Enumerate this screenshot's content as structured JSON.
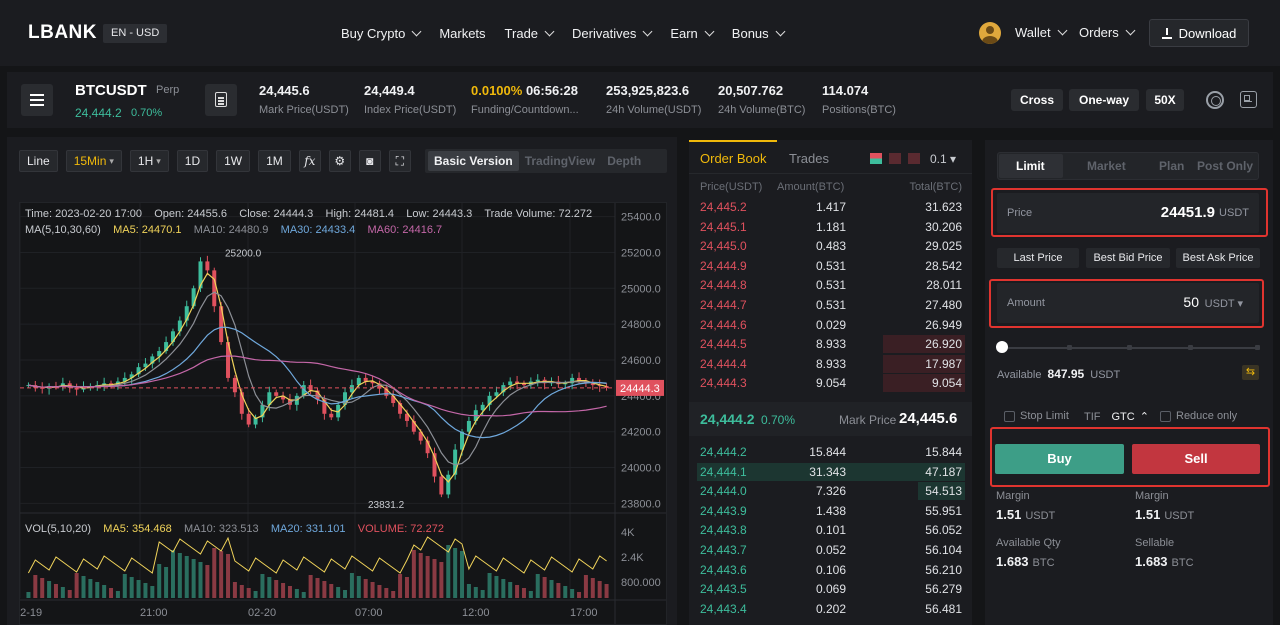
{
  "nav": {
    "logo": "LBANK",
    "lang": "EN - USD",
    "items": [
      "Buy Crypto",
      "Markets",
      "Trade",
      "Derivatives",
      "Earn",
      "Bonus"
    ],
    "wallet": "Wallet",
    "orders": "Orders",
    "download": "Download"
  },
  "ticker": {
    "symbol": "BTCUSDT",
    "tag": "Perp",
    "price": "24,444.2",
    "change": "0.70%",
    "stats": [
      {
        "value": "24,445.6",
        "label": "Mark Price(USDT)"
      },
      {
        "value": "24,449.4",
        "label": "Index Price(USDT)"
      },
      {
        "value": "0.0100%",
        "value2": "06:56:28",
        "label": "Funding/Countdown..."
      },
      {
        "value": "253,925,823.6",
        "label": "24h Volume(USDT)"
      },
      {
        "value": "20,507.762",
        "label": "24h Volume(BTC)"
      },
      {
        "value": "114.074",
        "label": "Positions(BTC)"
      }
    ],
    "pills": [
      "Cross",
      "One-way",
      "50X"
    ],
    "colors": {
      "funding": "#f0b90b",
      "up": "#3dbd9c",
      "down": "#e0515e"
    }
  },
  "chart_toolbar": {
    "buttons": [
      "Line",
      "15Min",
      "1H",
      "1D",
      "1W",
      "1M"
    ],
    "active": "15Min",
    "icons": [
      "fx-icon",
      "settings-icon",
      "camera-icon",
      "fullscreen-icon"
    ],
    "views": [
      "Basic Version",
      "TradingView",
      "Depth"
    ],
    "active_view": "Basic Version"
  },
  "chart_info": {
    "time": "Time: 2023-02-20 17:00",
    "open": "Open: 24455.6",
    "close": "Close: 24444.3",
    "high": "High: 24481.4",
    "low": "Low: 24443.3",
    "trade_volume": "Trade Volume: 72.272",
    "ma_label": "MA(5,10,30,60)",
    "ma5": "MA5: 24470.1",
    "ma10": "MA10: 24480.9",
    "ma30": "MA30: 24433.4",
    "ma60": "MA60: 24416.7",
    "vol_label": "VOL(5,10,20)",
    "vma5": "MA5: 354.468",
    "vma10": "MA10: 323.513",
    "vma20": "MA20: 331.101",
    "volume": "VOLUME: 72.272",
    "high_mark": "25200.0",
    "low_mark": "23831.2",
    "last_price": "24444.3"
  },
  "chart_data": {
    "type": "candlestick",
    "y_ticks": [
      "25400.0",
      "25200.0",
      "25000.0",
      "24800.0",
      "24600.0",
      "24400.0",
      "24200.0",
      "24000.0",
      "23800.0"
    ],
    "ylim": [
      23780,
      25420
    ],
    "x_ticks": [
      "02-19",
      "21:00",
      "02-20",
      "07:00",
      "12:00",
      "17:00"
    ],
    "volume_ticks": [
      "4K",
      "2.4K",
      "800.000"
    ],
    "close_path": [
      24460,
      24445,
      24440,
      24455,
      24450,
      24470,
      24445,
      24435,
      24450,
      24455,
      24460,
      24470,
      24455,
      24480,
      24500,
      24520,
      24560,
      24580,
      24620,
      24650,
      24700,
      24760,
      24820,
      24900,
      25000,
      25150,
      25100,
      24900,
      24700,
      24500,
      24420,
      24300,
      24240,
      24280,
      24350,
      24420,
      24400,
      24380,
      24350,
      24400,
      24460,
      24430,
      24380,
      24300,
      24280,
      24350,
      24420,
      24460,
      24500,
      24480,
      24470,
      24440,
      24400,
      24360,
      24300,
      24260,
      24200,
      24150,
      24080,
      23950,
      23850,
      23960,
      24100,
      24200,
      24260,
      24320,
      24350,
      24400,
      24420,
      24460,
      24480,
      24470,
      24460,
      24480,
      24490,
      24470,
      24480,
      24465,
      24470,
      24500,
      24485,
      24470,
      24460,
      24455,
      24444
    ]
  },
  "order_book": {
    "tabs": [
      "Order Book",
      "Trades"
    ],
    "precision": "0.1",
    "headers": [
      "Price(USDT)",
      "Amount(BTC)",
      "Total(BTC)"
    ],
    "asks": [
      [
        "24,445.2",
        "1.417",
        "31.623"
      ],
      [
        "24,445.1",
        "1.181",
        "30.206"
      ],
      [
        "24,445.0",
        "0.483",
        "29.025"
      ],
      [
        "24,444.9",
        "0.531",
        "28.542"
      ],
      [
        "24,444.8",
        "0.531",
        "28.011"
      ],
      [
        "24,444.7",
        "0.531",
        "27.480"
      ],
      [
        "24,444.6",
        "0.029",
        "26.949"
      ],
      [
        "24,444.5",
        "8.933",
        "26.920"
      ],
      [
        "24,444.4",
        "8.933",
        "17.987"
      ],
      [
        "24,444.3",
        "9.054",
        "9.054"
      ]
    ],
    "mid_price": "24,444.2",
    "mid_change": "0.70%",
    "mark_label": "Mark Price",
    "mark_price": "24,445.6",
    "bids": [
      [
        "24,444.2",
        "15.844",
        "15.844"
      ],
      [
        "24,444.1",
        "31.343",
        "47.187"
      ],
      [
        "24,444.0",
        "7.326",
        "54.513"
      ],
      [
        "24,443.9",
        "1.438",
        "55.951"
      ],
      [
        "24,443.8",
        "0.101",
        "56.052"
      ],
      [
        "24,443.7",
        "0.052",
        "56.104"
      ],
      [
        "24,443.6",
        "0.106",
        "56.210"
      ],
      [
        "24,443.5",
        "0.069",
        "56.279"
      ],
      [
        "24,443.4",
        "0.202",
        "56.481"
      ]
    ]
  },
  "trade": {
    "tabs": [
      "Limit",
      "Market",
      "Plan",
      "Post Only"
    ],
    "price_label": "Price",
    "price_value": "24451.9",
    "price_unit": "USDT",
    "price_chips": [
      "Last Price",
      "Best Bid Price",
      "Best Ask Price"
    ],
    "amount_label": "Amount",
    "amount_value": "50",
    "amount_unit": "USDT",
    "available_label": "Available",
    "available_value": "847.95",
    "available_unit": "USDT",
    "stop_limit": "Stop Limit",
    "tif": "TIF",
    "gtc": "GTC",
    "reduce_only": "Reduce only",
    "buy": "Buy",
    "sell": "Sell",
    "margin_label": "Margin",
    "buy_margin": "1.51",
    "sell_margin": "1.51",
    "margin_unit": "USDT",
    "avail_qty_label": "Available Qty",
    "sellable_label": "Sellable",
    "avail_qty": "1.683",
    "sellable": "1.683",
    "qty_unit": "BTC"
  }
}
